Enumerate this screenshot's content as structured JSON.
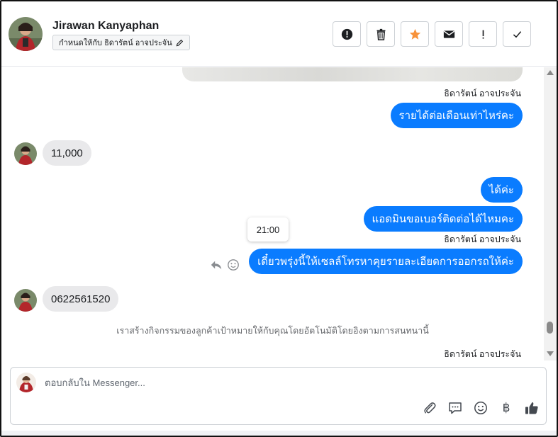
{
  "header": {
    "contact_name": "Jirawan Kanyaphan",
    "assign_label": "กำหนดให้กับ ธิดารัตน์ อาจประจัน",
    "actions": [
      {
        "icon": "alert-circle-icon",
        "name": "mark-spam-button"
      },
      {
        "icon": "trash-icon",
        "name": "delete-button"
      },
      {
        "icon": "star-icon",
        "name": "star-button"
      },
      {
        "icon": "envelope-icon",
        "name": "mark-unread-button"
      },
      {
        "icon": "exclamation-icon",
        "name": "flag-button"
      },
      {
        "icon": "checkmark-icon",
        "name": "mark-done-button"
      }
    ]
  },
  "messages": {
    "sender_1": "ธิดารัตน์ อาจประจัน",
    "out_1": "รายได้ต่อเดือนเท่าไหร่คะ",
    "in_1": "11,000",
    "out_2": "ได้ค่ะ",
    "out_3": "แอดมินขอเบอร์ติดต่อได้ไหมคะ",
    "sender_2": "ธิดารัตน์ อาจประจัน",
    "tooltip_time": "21:00",
    "out_4": "เดี๋ยวพรุ่งนี้ให้เซลล์โทรหาคุยรายละเอียดการออกรถให้ค่ะ",
    "in_2": "0622561520",
    "system_note": "เราสร้างกิจกรรมของลูกค้าเป้าหมายให้กับคุณโดยอัตโนมัติโดยอิงตามการสนทนานี้",
    "sender_3": "ธิดารัตน์ อาจประจัน"
  },
  "composer": {
    "placeholder": "ตอบกลับใน Messenger...",
    "tools": [
      "attachment-icon",
      "saved-reply-icon",
      "emoji-icon",
      "baht-icon",
      "thumbs-up-icon"
    ],
    "baht_symbol": "฿"
  },
  "colors": {
    "outgoing_bubble": "#0a7cff",
    "incoming_bubble": "#e9e9eb",
    "star": "#f7923b"
  }
}
